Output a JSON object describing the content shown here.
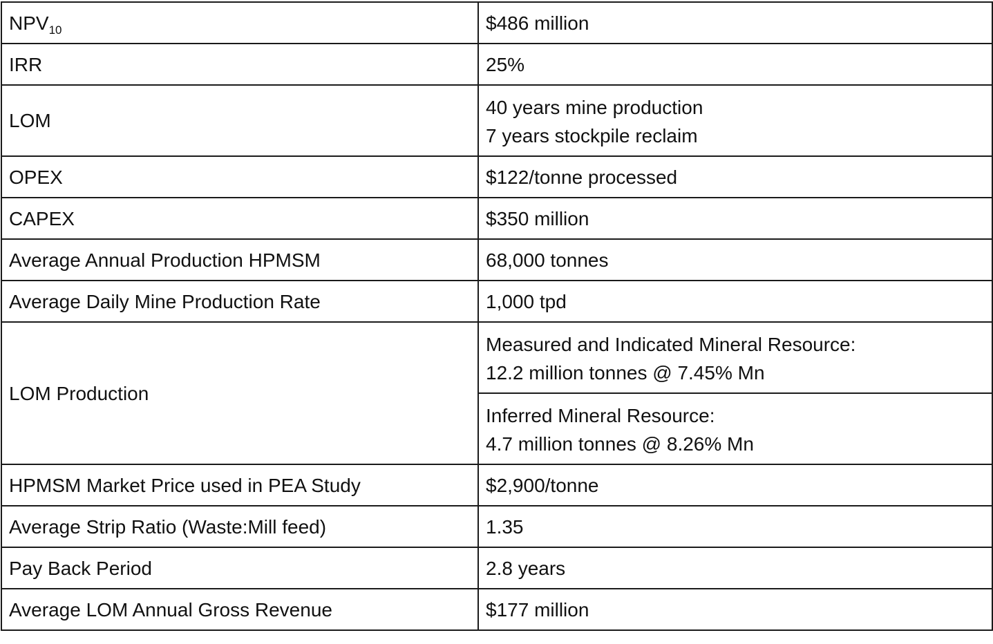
{
  "rows": [
    {
      "label": "NPV",
      "label_sub": "10",
      "value_lines": [
        "$486 million"
      ]
    },
    {
      "label": "IRR",
      "value_lines": [
        "25%"
      ]
    },
    {
      "label": "LOM",
      "value_lines": [
        "40 years mine production",
        "7 years stockpile reclaim"
      ]
    },
    {
      "label": "OPEX",
      "value_lines": [
        "$122/tonne processed"
      ]
    },
    {
      "label": "CAPEX",
      "value_lines": [
        "$350 million"
      ]
    },
    {
      "label": "Average Annual Production HPMSM",
      "value_lines": [
        "68,000 tonnes"
      ]
    },
    {
      "label": "Average Daily Mine Production Rate",
      "value_lines": [
        "1,000 tpd"
      ]
    },
    {
      "label": "LOM Production",
      "value_lines": [
        "Measured and Indicated Mineral Resource:",
        "12.2 million tonnes @ 7.45% Mn"
      ]
    },
    {
      "label": "",
      "value_lines": [
        "Inferred Mineral Resource:",
        "4.7 million tonnes @ 8.26% Mn"
      ]
    },
    {
      "label": "HPMSM Market Price used in PEA Study",
      "value_lines": [
        "$2,900/tonne"
      ]
    },
    {
      "label": "Average Strip Ratio (Waste:Mill feed)",
      "value_lines": [
        "1.35"
      ]
    },
    {
      "label": "Pay Back Period",
      "value_lines": [
        "2.8 years"
      ]
    },
    {
      "label": "Average LOM Annual Gross Revenue",
      "value_lines": [
        "$177 million"
      ]
    }
  ]
}
